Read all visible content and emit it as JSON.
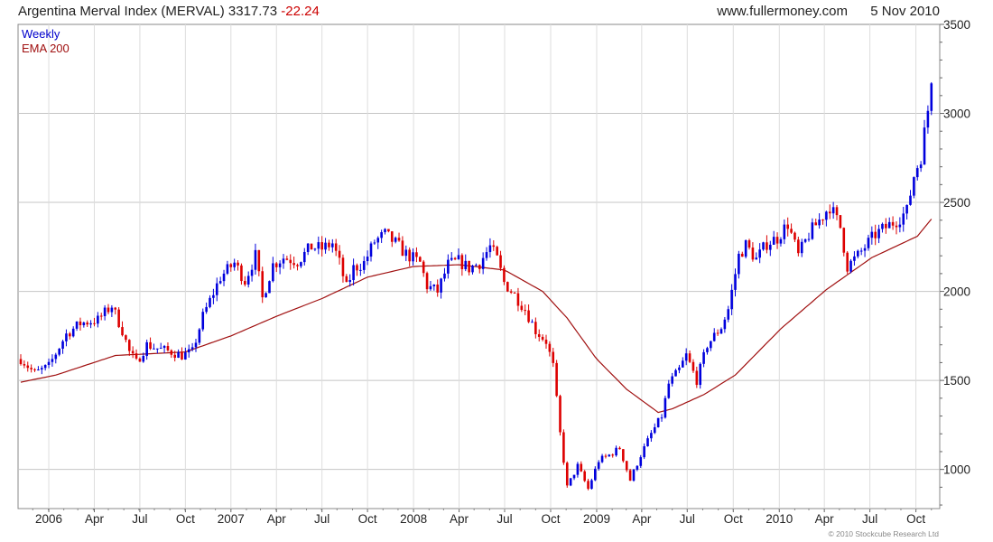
{
  "header": {
    "title": "Argentina Merval Index (MERVAL)",
    "last": "3317.73",
    "change": "-22.24",
    "site": "www.fullermoney.com",
    "date": "5 Nov 2010"
  },
  "legend": {
    "weekly": "Weekly",
    "ema": "EMA 200"
  },
  "copyright": "© 2010 Stockcube Research Ltd",
  "colors": {
    "up": "#0000dd",
    "down": "#dd0000",
    "ema": "#a01010",
    "grid": "#dddddd",
    "change": "#cc0000",
    "weekly": "#0000cc"
  },
  "chart_data": {
    "type": "candlestick",
    "frequency": "weekly",
    "x_axis": {
      "range": [
        "2005-11-07",
        "2010-11-05"
      ],
      "ticks": [
        {
          "date": "2006-01-02",
          "label": "2006"
        },
        {
          "date": "2006-04-03",
          "label": "Apr"
        },
        {
          "date": "2006-07-03",
          "label": "Jul"
        },
        {
          "date": "2006-10-02",
          "label": "Oct"
        },
        {
          "date": "2007-01-01",
          "label": "2007"
        },
        {
          "date": "2007-04-02",
          "label": "Apr"
        },
        {
          "date": "2007-07-02",
          "label": "Jul"
        },
        {
          "date": "2007-10-01",
          "label": "Oct"
        },
        {
          "date": "2008-01-01",
          "label": "2008"
        },
        {
          "date": "2008-04-01",
          "label": "Apr"
        },
        {
          "date": "2008-07-01",
          "label": "Jul"
        },
        {
          "date": "2008-10-01",
          "label": "Oct"
        },
        {
          "date": "2009-01-01",
          "label": "2009"
        },
        {
          "date": "2009-04-01",
          "label": "Apr"
        },
        {
          "date": "2009-07-01",
          "label": "Jul"
        },
        {
          "date": "2009-10-01",
          "label": "Oct"
        },
        {
          "date": "2010-01-01",
          "label": "2010"
        },
        {
          "date": "2010-04-01",
          "label": "Apr"
        },
        {
          "date": "2010-07-01",
          "label": "Jul"
        },
        {
          "date": "2010-10-01",
          "label": "Oct"
        }
      ]
    },
    "y_axis": {
      "position": "right",
      "ylim": [
        780,
        3500
      ],
      "ticks": [
        1000,
        1500,
        2000,
        2500,
        3000,
        3500
      ],
      "minor_step": 100
    },
    "grid": true,
    "legend_position": "top-left",
    "price_anchors": [
      [
        "2005-11-07",
        1620
      ],
      [
        "2005-12-05",
        1540
      ],
      [
        "2006-01-02",
        1580
      ],
      [
        "2006-02-06",
        1760
      ],
      [
        "2006-03-06",
        1820
      ],
      [
        "2006-04-10",
        1840
      ],
      [
        "2006-05-08",
        1920
      ],
      [
        "2006-05-29",
        1780
      ],
      [
        "2006-06-12",
        1660
      ],
      [
        "2006-06-26",
        1600
      ],
      [
        "2006-07-17",
        1700
      ],
      [
        "2006-08-07",
        1680
      ],
      [
        "2006-09-04",
        1660
      ],
      [
        "2006-09-25",
        1640
      ],
      [
        "2006-10-16",
        1660
      ],
      [
        "2006-11-06",
        1860
      ],
      [
        "2006-12-11",
        2080
      ],
      [
        "2007-01-08",
        2160
      ],
      [
        "2007-01-29",
        2060
      ],
      [
        "2007-02-19",
        2200
      ],
      [
        "2007-03-05",
        1960
      ],
      [
        "2007-03-26",
        2150
      ],
      [
        "2007-04-16",
        2190
      ],
      [
        "2007-05-14",
        2170
      ],
      [
        "2007-06-11",
        2250
      ],
      [
        "2007-07-02",
        2240
      ],
      [
        "2007-07-23",
        2270
      ],
      [
        "2007-08-06",
        2160
      ],
      [
        "2007-08-20",
        2020
      ],
      [
        "2007-09-03",
        2130
      ],
      [
        "2007-09-24",
        2160
      ],
      [
        "2007-10-15",
        2280
      ],
      [
        "2007-11-05",
        2320
      ],
      [
        "2007-11-26",
        2270
      ],
      [
        "2007-12-17",
        2210
      ],
      [
        "2008-01-14",
        2160
      ],
      [
        "2008-01-28",
        2030
      ],
      [
        "2008-02-18",
        2000
      ],
      [
        "2008-03-10",
        2150
      ],
      [
        "2008-03-31",
        2170
      ],
      [
        "2008-04-21",
        2130
      ],
      [
        "2008-05-12",
        2160
      ],
      [
        "2008-06-02",
        2250
      ],
      [
        "2008-06-16",
        2180
      ],
      [
        "2008-06-30",
        2050
      ],
      [
        "2008-07-21",
        1980
      ],
      [
        "2008-08-11",
        1900
      ],
      [
        "2008-09-01",
        1780
      ],
      [
        "2008-09-22",
        1720
      ],
      [
        "2008-10-06",
        1580
      ],
      [
        "2008-10-20",
        1200
      ],
      [
        "2008-11-03",
        900
      ],
      [
        "2008-11-24",
        1020
      ],
      [
        "2008-12-15",
        890
      ],
      [
        "2009-01-05",
        1050
      ],
      [
        "2009-01-26",
        1080
      ],
      [
        "2009-02-16",
        1120
      ],
      [
        "2009-03-09",
        940
      ],
      [
        "2009-03-30",
        1080
      ],
      [
        "2009-04-20",
        1200
      ],
      [
        "2009-05-11",
        1300
      ],
      [
        "2009-05-25",
        1480
      ],
      [
        "2009-06-15",
        1560
      ],
      [
        "2009-06-29",
        1640
      ],
      [
        "2009-07-20",
        1500
      ],
      [
        "2009-08-10",
        1700
      ],
      [
        "2009-09-07",
        1800
      ],
      [
        "2009-09-21",
        1900
      ],
      [
        "2009-10-12",
        2200
      ],
      [
        "2009-10-26",
        2260
      ],
      [
        "2009-11-16",
        2180
      ],
      [
        "2009-12-07",
        2270
      ],
      [
        "2009-12-28",
        2300
      ],
      [
        "2010-01-18",
        2380
      ],
      [
        "2010-02-08",
        2200
      ],
      [
        "2010-03-01",
        2320
      ],
      [
        "2010-03-22",
        2400
      ],
      [
        "2010-04-12",
        2480
      ],
      [
        "2010-05-03",
        2360
      ],
      [
        "2010-05-17",
        2140
      ],
      [
        "2010-06-07",
        2200
      ],
      [
        "2010-06-21",
        2250
      ],
      [
        "2010-07-12",
        2320
      ],
      [
        "2010-08-02",
        2360
      ],
      [
        "2010-08-23",
        2400
      ],
      [
        "2010-09-13",
        2450
      ],
      [
        "2010-09-27",
        2650
      ],
      [
        "2010-10-11",
        2760
      ],
      [
        "2010-10-25",
        3020
      ],
      [
        "2010-11-05",
        3318
      ]
    ],
    "ema_200_anchors": [
      [
        "2005-11-07",
        1490
      ],
      [
        "2006-01-16",
        1530
      ],
      [
        "2006-05-15",
        1640
      ],
      [
        "2006-10-02",
        1660
      ],
      [
        "2007-01-01",
        1750
      ],
      [
        "2007-04-02",
        1860
      ],
      [
        "2007-07-02",
        1960
      ],
      [
        "2007-10-01",
        2080
      ],
      [
        "2008-01-01",
        2140
      ],
      [
        "2008-04-01",
        2150
      ],
      [
        "2008-07-01",
        2120
      ],
      [
        "2008-09-15",
        2000
      ],
      [
        "2008-11-03",
        1850
      ],
      [
        "2009-01-01",
        1620
      ],
      [
        "2009-03-02",
        1450
      ],
      [
        "2009-05-04",
        1320
      ],
      [
        "2009-06-01",
        1340
      ],
      [
        "2009-08-03",
        1420
      ],
      [
        "2009-10-05",
        1530
      ],
      [
        "2010-01-04",
        1790
      ],
      [
        "2010-04-05",
        2010
      ],
      [
        "2010-07-05",
        2190
      ],
      [
        "2010-10-04",
        2310
      ],
      [
        "2010-11-05",
        2420
      ]
    ]
  }
}
